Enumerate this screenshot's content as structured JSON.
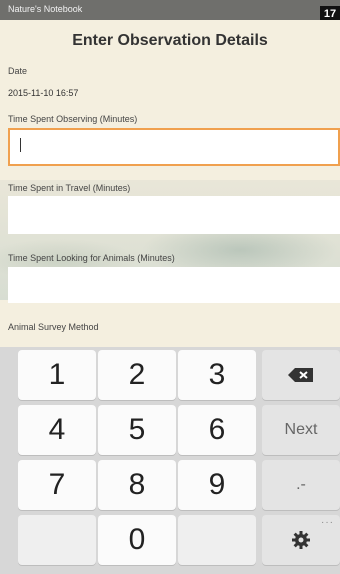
{
  "status_bar": {
    "app_name": "Nature's Notebook",
    "badge": "17"
  },
  "form": {
    "title": "Enter Observation Details",
    "date_label": "Date",
    "date_value": "2015-11-10 16:57",
    "fields": [
      {
        "label": "Time Spent Observing (Minutes)",
        "value": ""
      },
      {
        "label": "Time Spent in Travel (Minutes)",
        "value": ""
      },
      {
        "label": "Time Spent Looking for Animals (Minutes)",
        "value": ""
      }
    ],
    "survey_method_label": "Animal Survey Method"
  },
  "keypad": {
    "keys": [
      "1",
      "2",
      "3",
      "4",
      "5",
      "6",
      "7",
      "8",
      "9",
      "0"
    ],
    "next_label": "Next",
    "punct_label": ".-",
    "backspace_icon": "backspace-icon",
    "settings_icon": "gear-icon",
    "more_label": "···"
  },
  "colors": {
    "focus_border": "#f0a04e",
    "status_bar": "#6f6f6c",
    "form_bg": "#f4efdf",
    "keypad_bg": "#d7d7d7"
  }
}
